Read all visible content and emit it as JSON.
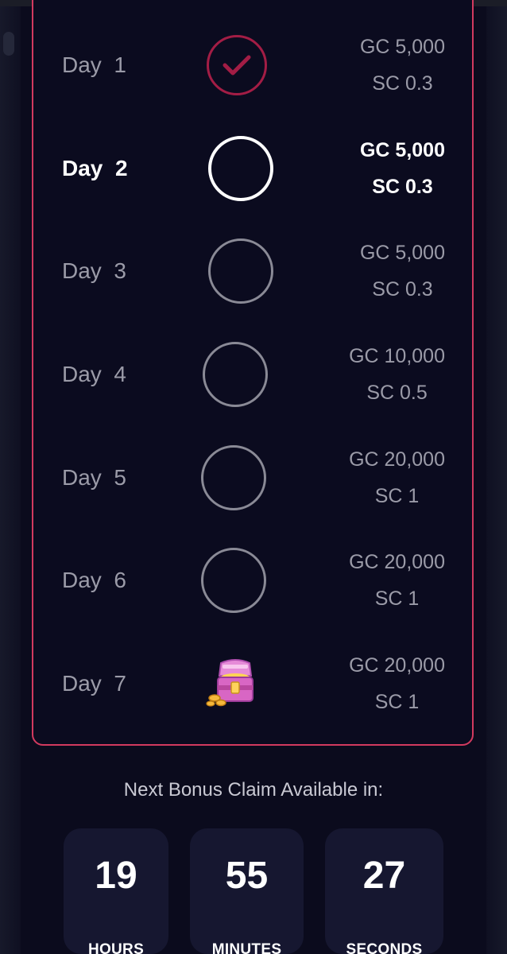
{
  "rewards": [
    {
      "day_word": "Day",
      "day_number": "1",
      "gc": "GC 5,000",
      "sc": "SC 0.3",
      "state": "claimed",
      "icon": "check-circle-icon"
    },
    {
      "day_word": "Day",
      "day_number": "2",
      "gc": "GC 5,000",
      "sc": "SC 0.3",
      "state": "active",
      "icon": "circle-icon"
    },
    {
      "day_word": "Day",
      "day_number": "3",
      "gc": "GC 5,000",
      "sc": "SC 0.3",
      "state": "upcoming",
      "icon": "circle-icon"
    },
    {
      "day_word": "Day",
      "day_number": "4",
      "gc": "GC 10,000",
      "sc": "SC 0.5",
      "state": "upcoming",
      "icon": "circle-icon"
    },
    {
      "day_word": "Day",
      "day_number": "5",
      "gc": "GC 20,000",
      "sc": "SC 1",
      "state": "upcoming",
      "icon": "circle-icon"
    },
    {
      "day_word": "Day",
      "day_number": "6",
      "gc": "GC 20,000",
      "sc": "SC 1",
      "state": "upcoming",
      "icon": "circle-icon"
    },
    {
      "day_word": "Day",
      "day_number": "7",
      "gc": "GC 20,000",
      "sc": "SC 1",
      "state": "upcoming",
      "icon": "treasure-chest-icon"
    }
  ],
  "next_claim": {
    "label": "Next Bonus Claim Available in:",
    "hours": "19",
    "hours_label": "HOURS",
    "minutes": "55",
    "minutes_label": "MINUTES",
    "seconds": "27",
    "seconds_label": "SECONDS"
  },
  "colors": {
    "background": "#0b0b1d",
    "card_border": "#d23a5f",
    "claimed_check": "#a31d45",
    "timer_box": "#161730"
  }
}
